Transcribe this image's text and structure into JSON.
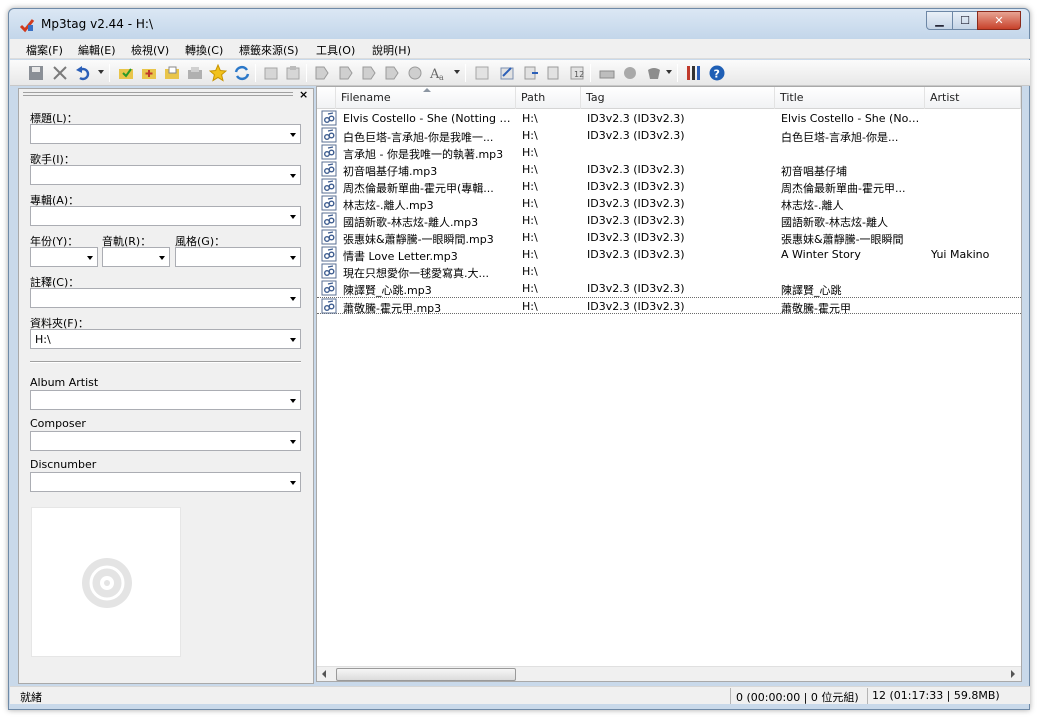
{
  "window": {
    "title": "Mp3tag v2.44  -  H:\\"
  },
  "menu": [
    "檔案(F)",
    "編輯(E)",
    "檢視(V)",
    "轉換(C)",
    "標籤來源(S)",
    "工具(O)",
    "說明(H)"
  ],
  "panel": {
    "close_label": "×",
    "fields": {
      "title_label": "標題(L)：",
      "artist_label": "歌手(I)：",
      "album_label": "專輯(A)：",
      "year_label": "年份(Y)：",
      "track_label": "音軌(R)：",
      "genre_label": "風格(G)：",
      "comment_label": "註釋(C)：",
      "folder_label": "資料夾(F)：",
      "folder_value": "H:\\",
      "album_artist_label": "Album Artist",
      "composer_label": "Composer",
      "discnumber_label": "Discnumber"
    }
  },
  "list": {
    "columns": [
      "Filename",
      "Path",
      "Tag",
      "Title",
      "Artist"
    ],
    "rows": [
      {
        "filename": "Elvis Costello - She (Notting Hill ...",
        "path": "H:\\",
        "tag": "ID3v2.3 (ID3v2.3)",
        "title": "Elvis Costello - She (Nottin...",
        "artist": ""
      },
      {
        "filename": "白色巨塔-言承旭-你是我唯一...",
        "path": "H:\\",
        "tag": "ID3v2.3 (ID3v2.3)",
        "title": "白色巨塔-言承旭-你是...",
        "artist": ""
      },
      {
        "filename": "言承旭 - 你是我唯一的執著.mp3",
        "path": "H:\\",
        "tag": "",
        "title": "",
        "artist": ""
      },
      {
        "filename": "初音唱基仔埔.mp3",
        "path": "H:\\",
        "tag": "ID3v2.3 (ID3v2.3)",
        "title": "初音唱基仔埔",
        "artist": ""
      },
      {
        "filename": "周杰倫最新單曲-霍元甲(專輯...",
        "path": "H:\\",
        "tag": "ID3v2.3 (ID3v2.3)",
        "title": "周杰倫最新單曲-霍元甲...",
        "artist": ""
      },
      {
        "filename": "林志炫-.離人.mp3",
        "path": "H:\\",
        "tag": "ID3v2.3 (ID3v2.3)",
        "title": "林志炫-.離人",
        "artist": ""
      },
      {
        "filename": "國語新歌-林志炫-離人.mp3",
        "path": "H:\\",
        "tag": "ID3v2.3 (ID3v2.3)",
        "title": "國語新歌-林志炫-離人",
        "artist": ""
      },
      {
        "filename": "張惠妹&蕭靜騰-一眼瞬間.mp3",
        "path": "H:\\",
        "tag": "ID3v2.3 (ID3v2.3)",
        "title": "張惠妹&蕭靜騰-一眼瞬間",
        "artist": ""
      },
      {
        "filename": "情書 Love Letter.mp3",
        "path": "H:\\",
        "tag": "ID3v2.3 (ID3v2.3)",
        "title": "A Winter Story",
        "artist": "Yui Makino"
      },
      {
        "filename": "現在只想愛你一毬愛寫真.大...",
        "path": "H:\\",
        "tag": "",
        "title": "",
        "artist": ""
      },
      {
        "filename": "陳譯賢_心跳.mp3",
        "path": "H:\\",
        "tag": "ID3v2.3 (ID3v2.3)",
        "title": "陳譯賢_心跳",
        "artist": ""
      },
      {
        "filename": "蕭敬騰-霍元甲.mp3",
        "path": "H:\\",
        "tag": "ID3v2.3 (ID3v2.3)",
        "title": "蕭敬騰-霍元甲",
        "artist": ""
      }
    ]
  },
  "status": {
    "ready": "就緒",
    "selected": "0 (00:00:00 | 0 位元組)",
    "total": "12 (01:17:33 | 59.8MB)"
  },
  "colors": {
    "accent": "#1f5fb5"
  }
}
